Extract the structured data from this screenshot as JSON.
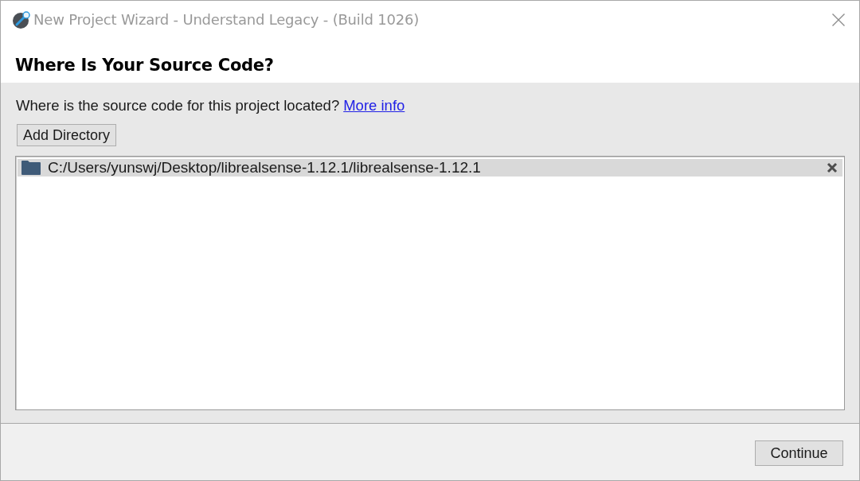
{
  "window": {
    "title": "New Project Wizard - Understand Legacy - (Build 1026)"
  },
  "header": {
    "title": "Where Is Your Source Code?"
  },
  "prompt": {
    "text": "Where is the source code for this project located?",
    "link": "More info"
  },
  "add_button": {
    "label": "Add Directory"
  },
  "directories": [
    {
      "path": "C:/Users/yunswj/Desktop/librealsense-1.12.1/librealsense-1.12.1",
      "selected": true
    }
  ],
  "footer": {
    "buttons": [
      "Continue"
    ]
  }
}
